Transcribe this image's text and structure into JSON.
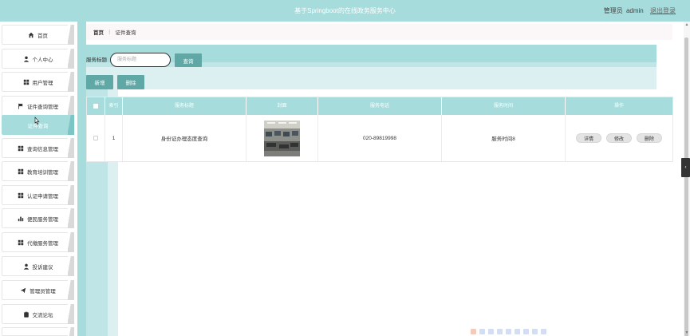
{
  "header": {
    "title": "基于Springboot的在线政务服务中心",
    "role_label": "管理员",
    "username": "admin",
    "logout_label": "退出登录"
  },
  "sidebar": {
    "items": [
      {
        "label": "首页",
        "icon": "home-icon",
        "active": false
      },
      {
        "label": "个人中心",
        "icon": "person-icon",
        "active": false
      },
      {
        "label": "用户管理",
        "icon": "grid-icon",
        "active": false
      },
      {
        "label": "证件查询管理",
        "icon": "flag-icon",
        "active": false
      },
      {
        "label": "证件查询",
        "icon": "",
        "active": true
      },
      {
        "label": "查询信息管理",
        "icon": "grid-icon",
        "active": false
      },
      {
        "label": "教育培训管理",
        "icon": "grid-icon",
        "active": false
      },
      {
        "label": "认证申请管理",
        "icon": "grid-icon",
        "active": false
      },
      {
        "label": "便民服务管理",
        "icon": "bar-chart-icon",
        "active": false
      },
      {
        "label": "代缴服务管理",
        "icon": "grid-icon",
        "active": false
      },
      {
        "label": "投诉建议",
        "icon": "person-icon",
        "active": false
      },
      {
        "label": "管理员管理",
        "icon": "send-icon",
        "active": false
      },
      {
        "label": "交流论坛",
        "icon": "clipboard-icon",
        "active": false
      }
    ]
  },
  "breadcrumb": {
    "home": "首页",
    "separator": "⋮",
    "current": "证件查询"
  },
  "search": {
    "label": "服务标题",
    "placeholder": "服务标题",
    "query_button": "查询"
  },
  "actions": {
    "add_button": "新增",
    "delete_button": "删除"
  },
  "table": {
    "headers": [
      "",
      "索引",
      "服务标题",
      "封面",
      "服务电话",
      "服务时间",
      "操作"
    ],
    "rows": [
      {
        "index": "1",
        "title": "身份证办理态度查询",
        "phone": "020-89819998",
        "time": "服务时间8",
        "buttons": [
          "详情",
          "修改",
          "删除"
        ]
      }
    ]
  },
  "colors": {
    "accent": "#a6dcdc",
    "button": "#5fa8a6",
    "band_light": "#bfe5e6",
    "band_lighter": "#dcf0f1"
  }
}
